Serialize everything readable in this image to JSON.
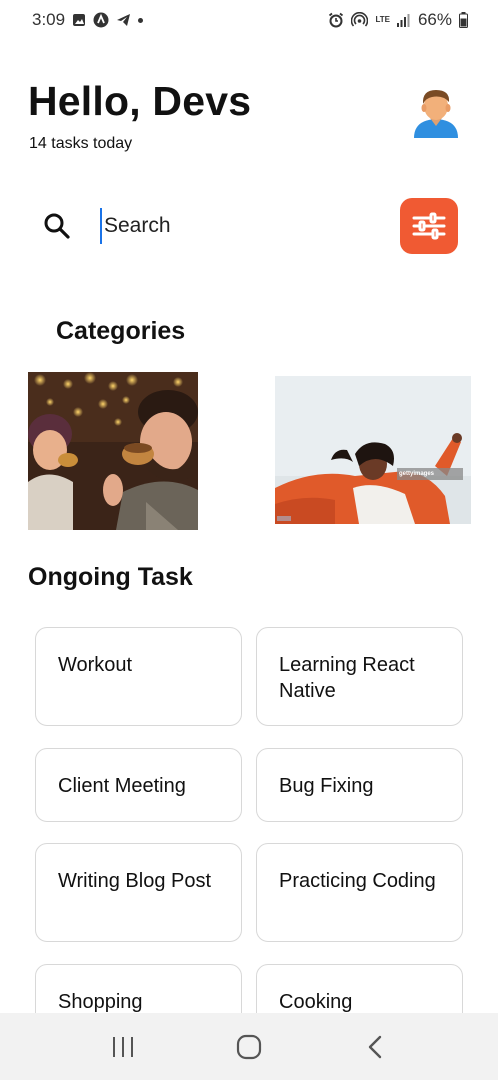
{
  "status_bar": {
    "time": "3:09",
    "battery": "66%",
    "network": "LTE"
  },
  "header": {
    "greeting": "Hello, Devs",
    "subtitle": "14 tasks today"
  },
  "search": {
    "placeholder": "Search",
    "value": ""
  },
  "categories": {
    "title": "Categories",
    "items": [
      {
        "name": "friends-eating-photo"
      },
      {
        "name": "woman-celebrating-photo",
        "watermark": "gettyimages"
      }
    ]
  },
  "ongoing": {
    "title": "Ongoing Task",
    "tasks": [
      {
        "label": "Workout"
      },
      {
        "label": "Learning React Native"
      },
      {
        "label": "Client Meeting"
      },
      {
        "label": "Bug Fixing"
      },
      {
        "label": "Writing Blog Post"
      },
      {
        "label": "Practicing Coding"
      },
      {
        "label": "Shopping"
      },
      {
        "label": "Cooking"
      }
    ]
  },
  "colors": {
    "accent": "#f05a33",
    "card_border": "#d8d8d8",
    "nav_bg": "#f2f2f2"
  },
  "icons": [
    "image-icon",
    "app-icon",
    "telegram-icon",
    "alarm-icon",
    "hotspot-icon",
    "signal-icon",
    "battery-icon",
    "search-icon",
    "sliders-icon",
    "recent-apps-icon",
    "home-icon",
    "back-icon"
  ]
}
